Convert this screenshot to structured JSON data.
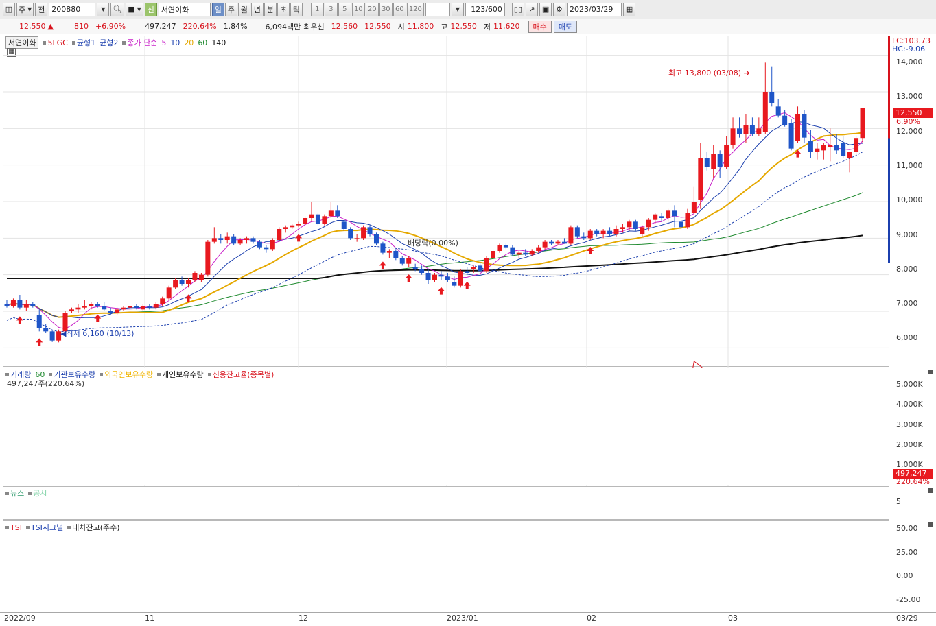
{
  "toolbar": {
    "period": "주",
    "prev_label": "전",
    "code": "200880",
    "new_badge": "신",
    "stock_name": "서연이화",
    "tabs": [
      "일",
      "주",
      "월",
      "년",
      "분",
      "초",
      "틱"
    ],
    "selected_tab": "일",
    "intervals": [
      "1",
      "3",
      "5",
      "10",
      "20",
      "30",
      "60",
      "120"
    ],
    "count": "123",
    "count_total": "/600",
    "date": "2023/03/29"
  },
  "quote": {
    "price": "12,550",
    "change": "810",
    "change_pct": "+6.90%",
    "volume": "497,247",
    "volume_ratio": "220.64%",
    "turnover": "1.84%",
    "amount": "6,094백만",
    "best_bid_label": "최우선",
    "best_bid": "12,560",
    "best_ask": "12,550",
    "open_label": "시",
    "open": "11,800",
    "high_label": "고",
    "high": "12,550",
    "low_label": "저",
    "low": "11,620",
    "buy_label": "매수",
    "sell_label": "매도"
  },
  "main_panel": {
    "legend": {
      "name": "서연이화",
      "lgc": "5LGC",
      "line1": "균형1",
      "line2": "균형2",
      "ma_label": "종가 단순",
      "ma_periods": [
        "5",
        "10",
        "20",
        "60",
        "140"
      ]
    },
    "lc_label": "LC:103.73",
    "hc_label": "HC:-9.06",
    "high_annotation": "최고 13,800 (03/08)",
    "low_annotation": "최저 6,160 (10/13)",
    "dividend_annotation": "배당락(0.00%)",
    "price_ticks": [
      "14,000",
      "13,000",
      "12,000",
      "11,000",
      "10,000",
      "9,000",
      "8,000",
      "7,000",
      "6,000"
    ],
    "last_price": "12,550",
    "last_pct": "6.90%"
  },
  "volume_panel": {
    "legend": [
      "거래량",
      "60",
      "기관보유수량",
      "외국인보유수량",
      "개인보유수량",
      "신용잔고율(종목별)"
    ],
    "info": "497,247주(220.64%)",
    "ticks": [
      "5,000K",
      "4,000K",
      "3,000K",
      "2,000K",
      "1,000K"
    ],
    "last_volume": "497,247",
    "last_pct": "220.64%"
  },
  "news_panel": {
    "legend": [
      "뉴스",
      "공시"
    ],
    "ticks": [
      "5"
    ]
  },
  "tsi_panel": {
    "legend": [
      "TSI",
      "TSI시그널",
      "대차잔고(주수)"
    ],
    "ticks": [
      "50.00",
      "25.00",
      "0.00",
      "-25.00"
    ]
  },
  "x_axis": {
    "labels": [
      "2022/09",
      "11",
      "12",
      "2023/01",
      "02",
      "03"
    ],
    "right_label": "03/29"
  },
  "chart_data": {
    "type": "candlestick",
    "ylim": [
      5500,
      14500
    ],
    "candles": [
      [
        7200,
        7300,
        7100,
        7150
      ],
      [
        7150,
        7350,
        7100,
        7300
      ],
      [
        7300,
        7450,
        7050,
        7100
      ],
      [
        7100,
        7300,
        7000,
        7200
      ],
      [
        7200,
        7250,
        7100,
        7150
      ],
      [
        6900,
        7050,
        6450,
        6550
      ],
      [
        6550,
        6650,
        6400,
        6450
      ],
      [
        6450,
        6500,
        6160,
        6200
      ],
      [
        6200,
        6500,
        6150,
        6450
      ],
      [
        6450,
        7000,
        6400,
        6950
      ],
      [
        7000,
        7100,
        6950,
        7050
      ],
      [
        7050,
        7200,
        6950,
        7100
      ],
      [
        7100,
        7300,
        7050,
        7150
      ],
      [
        7150,
        7250,
        7050,
        7200
      ],
      [
        7200,
        7250,
        7100,
        7150
      ],
      [
        7150,
        7250,
        7000,
        7050
      ],
      [
        7000,
        7100,
        6900,
        6950
      ],
      [
        6950,
        7100,
        6900,
        7050
      ],
      [
        7050,
        7150,
        7000,
        7100
      ],
      [
        7100,
        7200,
        7050,
        7150
      ],
      [
        7150,
        7200,
        7050,
        7100
      ],
      [
        7050,
        7200,
        7000,
        7150
      ],
      [
        7150,
        7200,
        7050,
        7100
      ],
      [
        7100,
        7250,
        7050,
        7200
      ],
      [
        7200,
        7400,
        7150,
        7350
      ],
      [
        7350,
        7700,
        7300,
        7650
      ],
      [
        7650,
        7900,
        7600,
        7850
      ],
      [
        7850,
        7950,
        7700,
        7750
      ],
      [
        7750,
        7900,
        7650,
        7850
      ],
      [
        7850,
        8100,
        7800,
        8050
      ],
      [
        7850,
        8050,
        7800,
        8000
      ],
      [
        8000,
        8950,
        7950,
        8900
      ],
      [
        8900,
        9300,
        8850,
        9000
      ],
      [
        9000,
        9100,
        8850,
        8950
      ],
      [
        8950,
        9150,
        8850,
        9050
      ],
      [
        9050,
        9100,
        8800,
        8850
      ],
      [
        8850,
        9000,
        8800,
        8950
      ],
      [
        8950,
        9050,
        8850,
        9000
      ],
      [
        9000,
        9050,
        8850,
        8900
      ],
      [
        8900,
        8950,
        8700,
        8750
      ],
      [
        8750,
        8800,
        8600,
        8700
      ],
      [
        8700,
        9000,
        8650,
        8950
      ],
      [
        8950,
        9300,
        8900,
        9250
      ],
      [
        9250,
        9350,
        9150,
        9300
      ],
      [
        9300,
        9400,
        9250,
        9350
      ],
      [
        9350,
        9450,
        9300,
        9400
      ],
      [
        9400,
        9600,
        9350,
        9550
      ],
      [
        9550,
        10000,
        9450,
        9650
      ],
      [
        9650,
        9700,
        9350,
        9400
      ],
      [
        9400,
        9650,
        9350,
        9600
      ],
      [
        9600,
        10000,
        9550,
        9750
      ],
      [
        9750,
        9900,
        9550,
        9600
      ],
      [
        9450,
        9500,
        9200,
        9250
      ],
      [
        9250,
        9300,
        8950,
        9000
      ],
      [
        9000,
        9100,
        8900,
        9000
      ],
      [
        9000,
        9350,
        8950,
        9300
      ],
      [
        9300,
        9350,
        9050,
        9100
      ],
      [
        9100,
        9150,
        8800,
        8850
      ],
      [
        8850,
        8900,
        8550,
        8600
      ],
      [
        8600,
        8700,
        8450,
        8650
      ],
      [
        8650,
        8700,
        8400,
        8450
      ],
      [
        8450,
        8500,
        8250,
        8300
      ],
      [
        8300,
        8500,
        8200,
        8450
      ],
      [
        8200,
        8300,
        8100,
        8150
      ],
      [
        8150,
        8250,
        8000,
        8050
      ],
      [
        8050,
        8150,
        7750,
        7850
      ],
      [
        7850,
        8050,
        7800,
        8000
      ],
      [
        8000,
        8100,
        7850,
        7950
      ],
      [
        7950,
        8050,
        7800,
        7850
      ],
      [
        7800,
        7950,
        7650,
        7700
      ],
      [
        7700,
        8150,
        7650,
        8100
      ],
      [
        8100,
        8200,
        8000,
        8050
      ],
      [
        8150,
        8250,
        8050,
        8200
      ],
      [
        8250,
        8350,
        8050,
        8100
      ],
      [
        8100,
        8500,
        8050,
        8450
      ],
      [
        8450,
        8700,
        8400,
        8650
      ],
      [
        8650,
        8850,
        8600,
        8800
      ],
      [
        8800,
        8850,
        8700,
        8750
      ],
      [
        8750,
        8800,
        8500,
        8550
      ],
      [
        8550,
        8650,
        8450,
        8600
      ],
      [
        8600,
        8700,
        8500,
        8550
      ],
      [
        8550,
        8700,
        8500,
        8650
      ],
      [
        8650,
        8800,
        8600,
        8750
      ],
      [
        8750,
        8950,
        8700,
        8900
      ],
      [
        8900,
        8950,
        8800,
        8850
      ],
      [
        8850,
        8950,
        8800,
        8900
      ],
      [
        8900,
        9000,
        8850,
        8850
      ],
      [
        8850,
        9350,
        8800,
        9300
      ],
      [
        9300,
        9350,
        9000,
        9050
      ],
      [
        9050,
        9150,
        8950,
        9000
      ],
      [
        9000,
        9250,
        8950,
        9200
      ],
      [
        9200,
        9250,
        9050,
        9100
      ],
      [
        9100,
        9250,
        9000,
        9200
      ],
      [
        9200,
        9300,
        9050,
        9100
      ],
      [
        9100,
        9350,
        9050,
        9250
      ],
      [
        9250,
        9400,
        9150,
        9300
      ],
      [
        9300,
        9500,
        9200,
        9450
      ],
      [
        9450,
        9500,
        9200,
        9250
      ],
      [
        9100,
        9350,
        9050,
        9300
      ],
      [
        9300,
        9550,
        9200,
        9500
      ],
      [
        9500,
        9700,
        9400,
        9650
      ],
      [
        9600,
        9700,
        9450,
        9550
      ],
      [
        9550,
        9800,
        9450,
        9750
      ],
      [
        9750,
        9900,
        9300,
        9600
      ],
      [
        9450,
        9600,
        9200,
        9300
      ],
      [
        9300,
        9800,
        9250,
        9700
      ],
      [
        9700,
        10400,
        9650,
        10000
      ],
      [
        10050,
        11600,
        9800,
        11200
      ],
      [
        11200,
        11350,
        10850,
        10950
      ],
      [
        10900,
        11550,
        10650,
        11300
      ],
      [
        11300,
        11400,
        10650,
        10950
      ],
      [
        10950,
        11800,
        10900,
        11550
      ],
      [
        11550,
        12300,
        11450,
        12000
      ],
      [
        12000,
        12300,
        11750,
        11850
      ],
      [
        11850,
        12400,
        11600,
        12100
      ],
      [
        12100,
        12300,
        11800,
        11850
      ],
      [
        11850,
        12300,
        11800,
        12000
      ],
      [
        11900,
        13800,
        11850,
        13000
      ],
      [
        13000,
        13700,
        12600,
        12700
      ],
      [
        12600,
        12800,
        12300,
        12350
      ],
      [
        12350,
        12500,
        12050,
        12100
      ],
      [
        12150,
        12250,
        11400,
        11450
      ],
      [
        11650,
        12600,
        11600,
        12400
      ],
      [
        12400,
        12500,
        11600,
        11750
      ],
      [
        11650,
        11950,
        11200,
        11350
      ],
      [
        11350,
        11600,
        11150,
        11450
      ],
      [
        11400,
        11600,
        11150,
        11550
      ],
      [
        11500,
        12000,
        11100,
        11550
      ],
      [
        11550,
        11850,
        11300,
        11400
      ],
      [
        11600,
        11800,
        11200,
        11250
      ],
      [
        11200,
        11300,
        10800,
        11350
      ],
      [
        11350,
        11800,
        11250,
        11740
      ],
      [
        11740,
        12550,
        11620,
        12550
      ]
    ]
  }
}
